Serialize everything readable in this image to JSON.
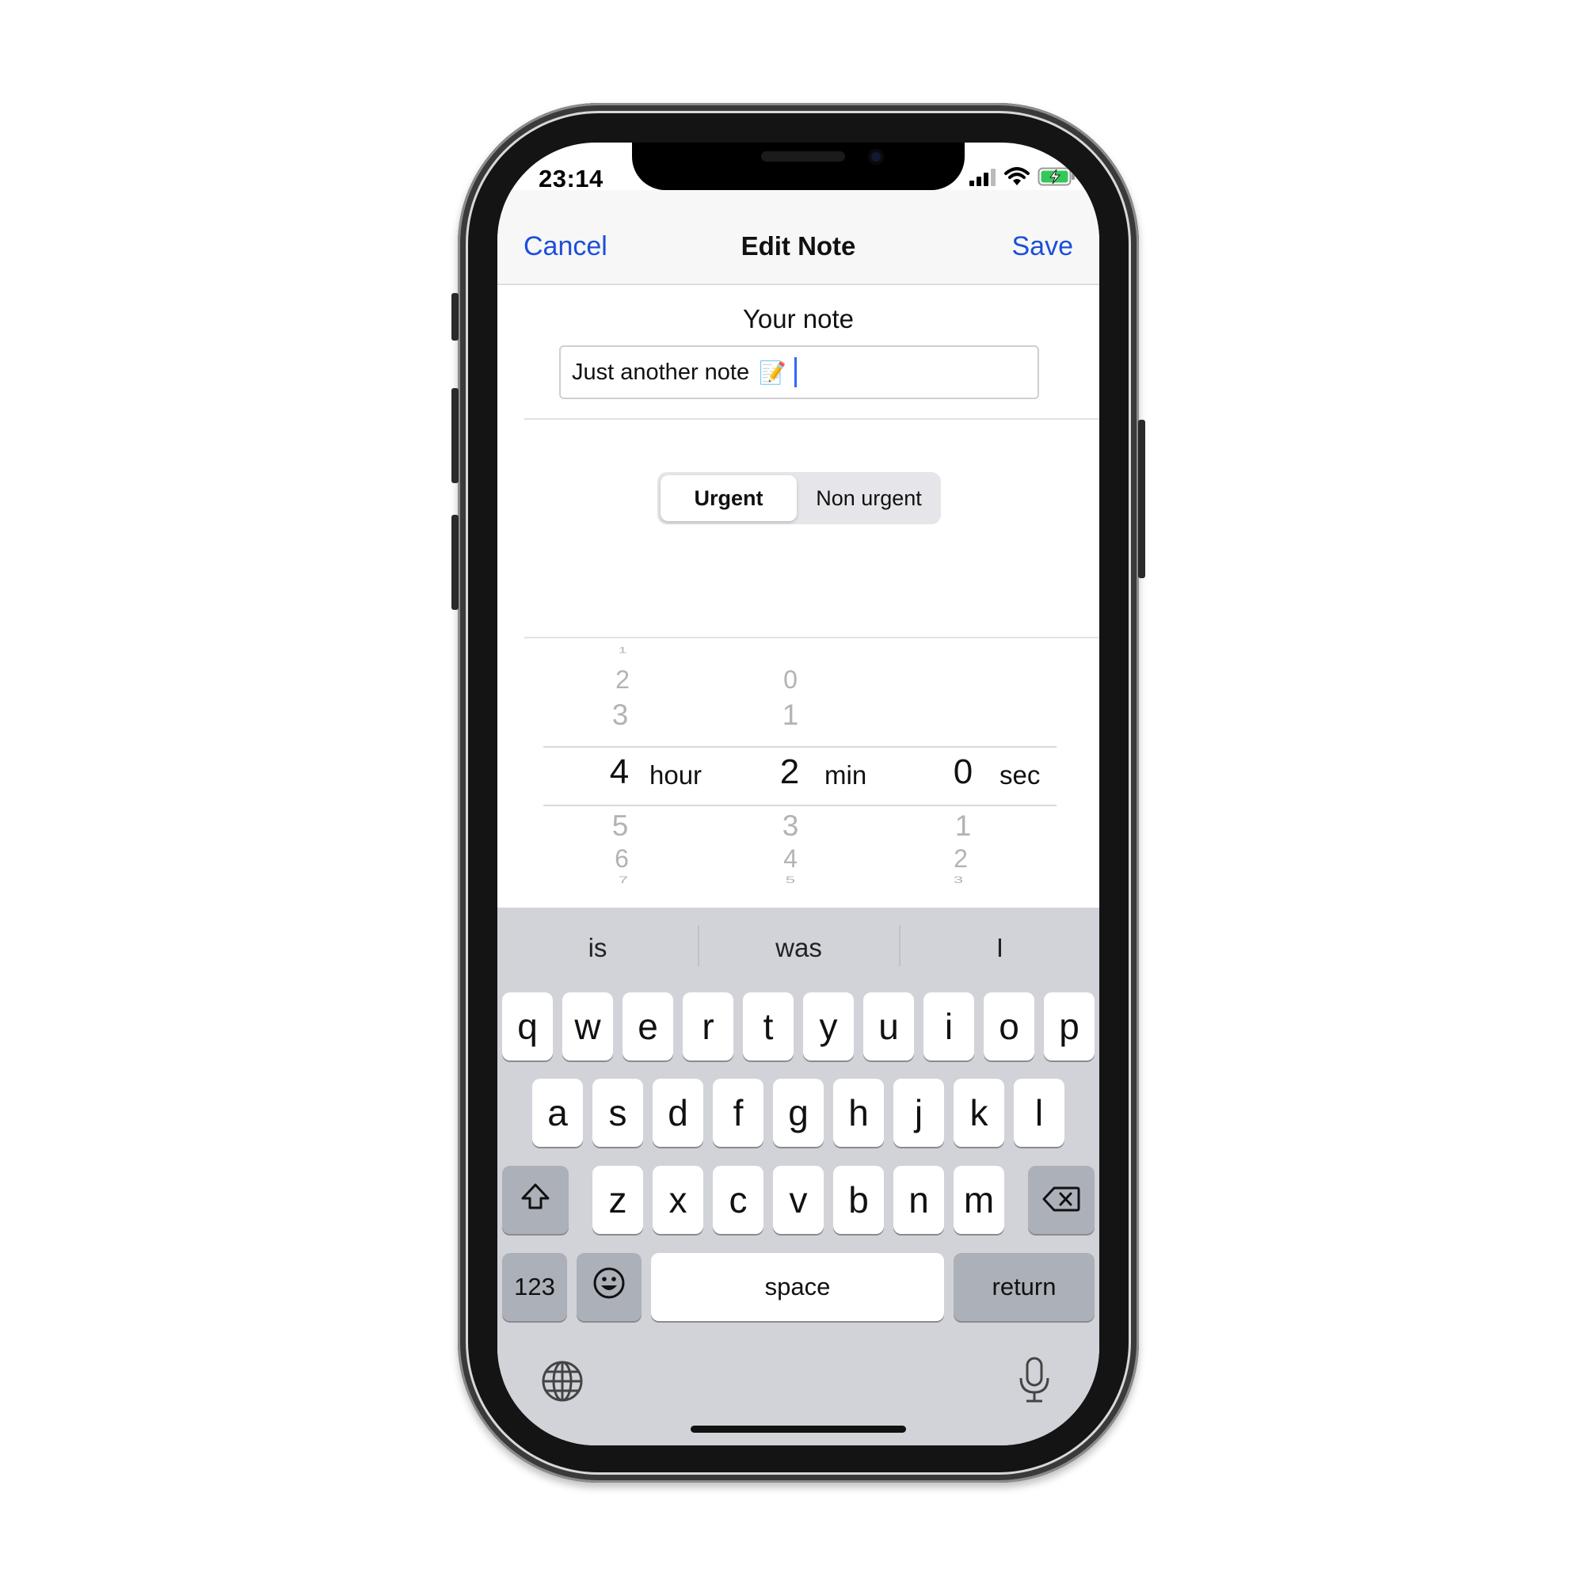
{
  "status_bar": {
    "time": "23:14"
  },
  "nav": {
    "cancel": "Cancel",
    "title": "Edit Note",
    "save": "Save"
  },
  "note": {
    "label": "Your note",
    "value": "Just another note",
    "emoji": "📝"
  },
  "priority": {
    "options": [
      "Urgent",
      "Non urgent"
    ],
    "selected": "Urgent"
  },
  "picker": {
    "hours": {
      "above": [
        "1",
        "2",
        "3"
      ],
      "selected": "4",
      "below": [
        "5",
        "6",
        "7"
      ],
      "unit": "hour"
    },
    "minutes": {
      "above": [
        "0",
        "1"
      ],
      "selected": "2",
      "below": [
        "3",
        "4",
        "5"
      ],
      "unit": "min"
    },
    "seconds": {
      "selected": "0",
      "below": [
        "1",
        "2",
        "3"
      ],
      "unit": "sec"
    }
  },
  "keyboard": {
    "suggestions": [
      "is",
      "was",
      "I"
    ],
    "row1": [
      "q",
      "w",
      "e",
      "r",
      "t",
      "y",
      "u",
      "i",
      "o",
      "p"
    ],
    "row2": [
      "a",
      "s",
      "d",
      "f",
      "g",
      "h",
      "j",
      "k",
      "l"
    ],
    "row3": [
      "z",
      "x",
      "c",
      "v",
      "b",
      "n",
      "m"
    ],
    "numbers_key": "123",
    "space_key": "space",
    "return_key": "return"
  },
  "colors": {
    "accent": "#1d4ed8",
    "caret": "#2f66ff",
    "keyboard_bg": "#d1d3d9",
    "battery": "#34c759"
  },
  "icons": [
    "signal-icon",
    "wifi-icon",
    "battery-charging-icon",
    "shift-icon",
    "backspace-icon",
    "emoji-icon",
    "globe-icon",
    "microphone-icon"
  ]
}
